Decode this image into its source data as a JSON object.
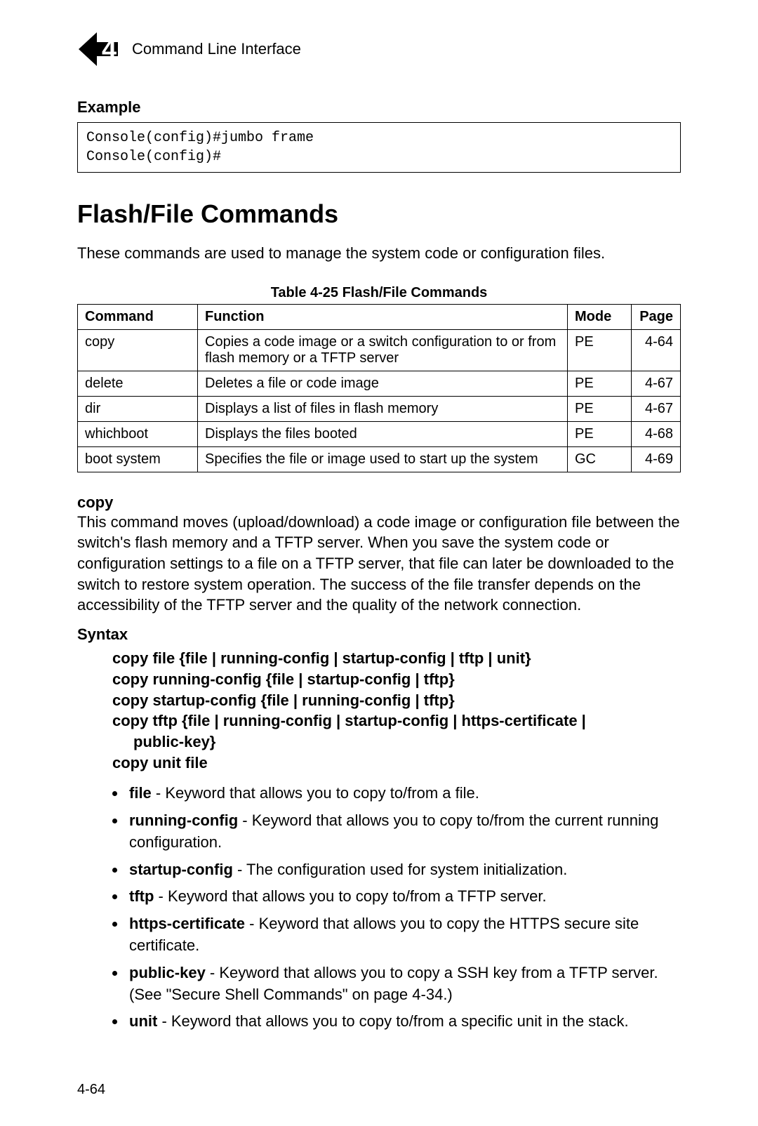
{
  "header": {
    "chapter_number": "4",
    "chapter_title": "Command Line Interface"
  },
  "example": {
    "heading": "Example",
    "code": "Console(config)#jumbo frame\nConsole(config)#"
  },
  "section": {
    "title": "Flash/File Commands",
    "intro": "These commands are used to manage the system code or configuration files."
  },
  "table": {
    "title": "Table 4-25   Flash/File Commands",
    "headers": {
      "command": "Command",
      "function": "Function",
      "mode": "Mode",
      "page": "Page"
    },
    "rows": [
      {
        "command": "copy",
        "function": "Copies a code image or a switch configuration to or from flash memory or a TFTP server",
        "mode": "PE",
        "page": "4-64"
      },
      {
        "command": "delete",
        "function": "Deletes a file or code image",
        "mode": "PE",
        "page": "4-67"
      },
      {
        "command": "dir",
        "function": "Displays a list of files in flash memory",
        "mode": "PE",
        "page": "4-67"
      },
      {
        "command": "whichboot",
        "function": "Displays the files booted",
        "mode": "PE",
        "page": "4-68"
      },
      {
        "command": "boot system",
        "function": "Specifies the file or image used to start up the system",
        "mode": "GC",
        "page": "4-69"
      }
    ]
  },
  "copy": {
    "heading": "copy",
    "description": "This command moves (upload/download) a code image or configuration file between the switch's flash memory and a TFTP server. When you save the system code or configuration settings to a file on a TFTP server, that file can later be downloaded to the switch to restore system operation. The success of the file transfer depends on the accessibility of the TFTP server and the quality of the network connection."
  },
  "syntax": {
    "heading": "Syntax",
    "l1": "copy file {file | running-config | startup-config | tftp | unit}",
    "l2": "copy running-config {file | startup-config | tftp}",
    "l3": "copy startup-config {file | running-config | tftp}",
    "l4a": "copy tftp {file | running-config | startup-config | https-certificate |",
    "l4b": "public-key}",
    "l5": "copy unit file"
  },
  "keywords": [
    {
      "kw": "file",
      "desc": " - Keyword that allows you to copy to/from a file."
    },
    {
      "kw": "running-config",
      "desc": " - Keyword that allows you to copy to/from the current running configuration."
    },
    {
      "kw": "startup-config",
      "desc": " - The configuration used for system initialization."
    },
    {
      "kw": "tftp",
      "desc": " - Keyword that allows you to copy to/from a TFTP server."
    },
    {
      "kw": "https-certificate",
      "desc": " - Keyword that allows you to copy the HTTPS secure site certificate."
    },
    {
      "kw": "public-key",
      "desc": " - Keyword that allows you to copy a SSH key from a TFTP server. (See \"Secure Shell Commands\" on page 4-34.)"
    },
    {
      "kw": "unit",
      "desc": " - Keyword that allows you to copy to/from a specific unit in the stack."
    }
  ],
  "page_number": "4-64"
}
